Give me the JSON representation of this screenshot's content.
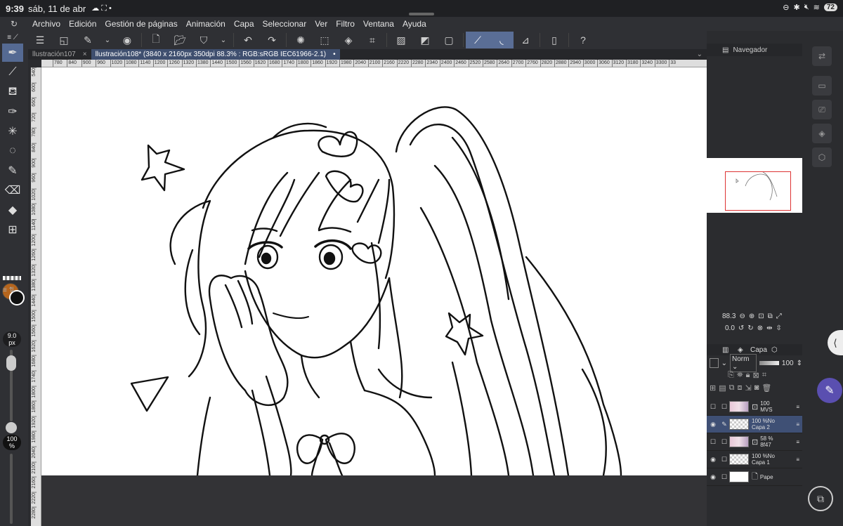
{
  "status": {
    "time": "9:39",
    "date": "sáb, 11 de abr",
    "battery": "72"
  },
  "menu": [
    "Archivo",
    "Edición",
    "Gestión de páginas",
    "Animación",
    "Capa",
    "Seleccionar",
    "Ver",
    "Filtro",
    "Ventana",
    "Ayuda"
  ],
  "tabs": [
    {
      "label": "llustración107",
      "close": "×"
    },
    {
      "label": "llustración108* (3840 x 2160px 350dpi 88.3% : RGB:sRGB IEC61966-2.1)",
      "close": "•"
    }
  ],
  "ruler_top": [
    "780",
    "840",
    "900",
    "960",
    "1020",
    "1080",
    "1140",
    "1200",
    "1260",
    "1320",
    "1380",
    "1440",
    "1500",
    "1560",
    "1620",
    "1680",
    "1740",
    "1800",
    "1860",
    "1920",
    "1980",
    "2040",
    "2100",
    "2160",
    "2220",
    "2280",
    "2340",
    "2400",
    "2460",
    "2520",
    "2580",
    "2640",
    "2700",
    "2760",
    "2820",
    "2880",
    "2940",
    "3000",
    "3060",
    "3120",
    "3180",
    "3240",
    "3300",
    "33"
  ],
  "ruler_left": [
    "540",
    "600",
    "660",
    "720",
    "780",
    "840",
    "900",
    "960",
    "1020",
    "1080",
    "1140",
    "1200",
    "1260",
    "1320",
    "1380",
    "1440",
    "1500",
    "1560",
    "1620",
    "1680",
    "1740",
    "1800",
    "1860",
    "1920",
    "1980",
    "2040",
    "2100",
    "2160",
    "2220",
    "2280"
  ],
  "brush": {
    "size_value": "9.0",
    "size_unit": "px",
    "opacity_value": "100",
    "opacity_unit": "%",
    "main_color": "#b5651d",
    "sub_color": "#111111"
  },
  "navigator": {
    "title": "Navegador",
    "zoom": "88.3",
    "angle": "0.0"
  },
  "layer_panel": {
    "title": "Capa",
    "blend": "Norm",
    "opacity": "100"
  },
  "layers": [
    {
      "visible": false,
      "line1": "100",
      "line2": "MVS",
      "thumb": "pic"
    },
    {
      "visible": true,
      "line1": "100 %No",
      "line2": "Capa 2",
      "thumb": "trans",
      "selected": true
    },
    {
      "visible": false,
      "line1": "58 %",
      "line2": "8f47",
      "thumb": "pic"
    },
    {
      "visible": true,
      "line1": "100 %No",
      "line2": "Capa 1",
      "thumb": "trans"
    },
    {
      "visible": true,
      "line1": "",
      "line2": "Pape",
      "thumb": "white"
    }
  ]
}
